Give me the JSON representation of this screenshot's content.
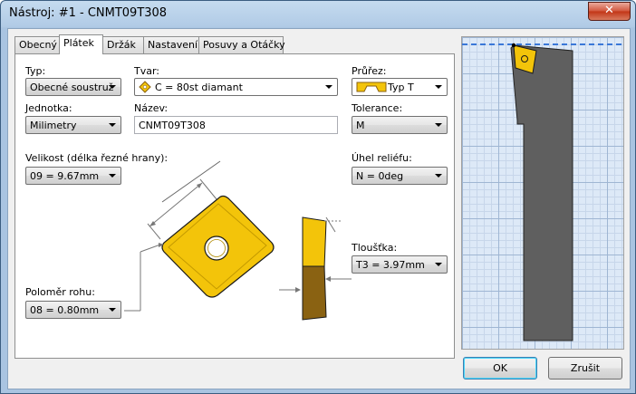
{
  "window": {
    "title": "Nástroj: #1 - CNMT09T308",
    "close_label": "✕"
  },
  "tabs": [
    {
      "label": "Obecný"
    },
    {
      "label": "Plátek"
    },
    {
      "label": "Držák"
    },
    {
      "label": "Nastavení"
    },
    {
      "label": "Posuvy a Otáčky"
    }
  ],
  "fields": {
    "typ": {
      "label": "Typ:",
      "value": "Obecné soustruž"
    },
    "tvar": {
      "label": "Tvar:",
      "value": "C = 80st diamant"
    },
    "prurez": {
      "label": "Průřez:",
      "value": "Typ T"
    },
    "jednotka": {
      "label": "Jednotka:",
      "value": "Milimetry"
    },
    "nazev": {
      "label": "Název:",
      "value": "CNMT09T308"
    },
    "tolerance": {
      "label": "Tolerance:",
      "value": "M"
    },
    "velikost": {
      "label": "Velikost (délka řezné hrany):",
      "value": "09 = 9.67mm"
    },
    "uhel": {
      "label": "Úhel reliéfu:",
      "value": "N = 0deg"
    },
    "tloustka": {
      "label": "Tloušťka:",
      "value": "T3 = 3.97mm"
    },
    "polomer": {
      "label": "Poloměr rohu:",
      "value": "08 = 0.80mm"
    }
  },
  "buttons": {
    "ok": "OK",
    "cancel": "Zrušit"
  },
  "colors": {
    "insert": "#f3c40a",
    "insert_dark": "#8a6212",
    "holder": "#5f5f5f",
    "accent_line": "#3a78d8"
  }
}
